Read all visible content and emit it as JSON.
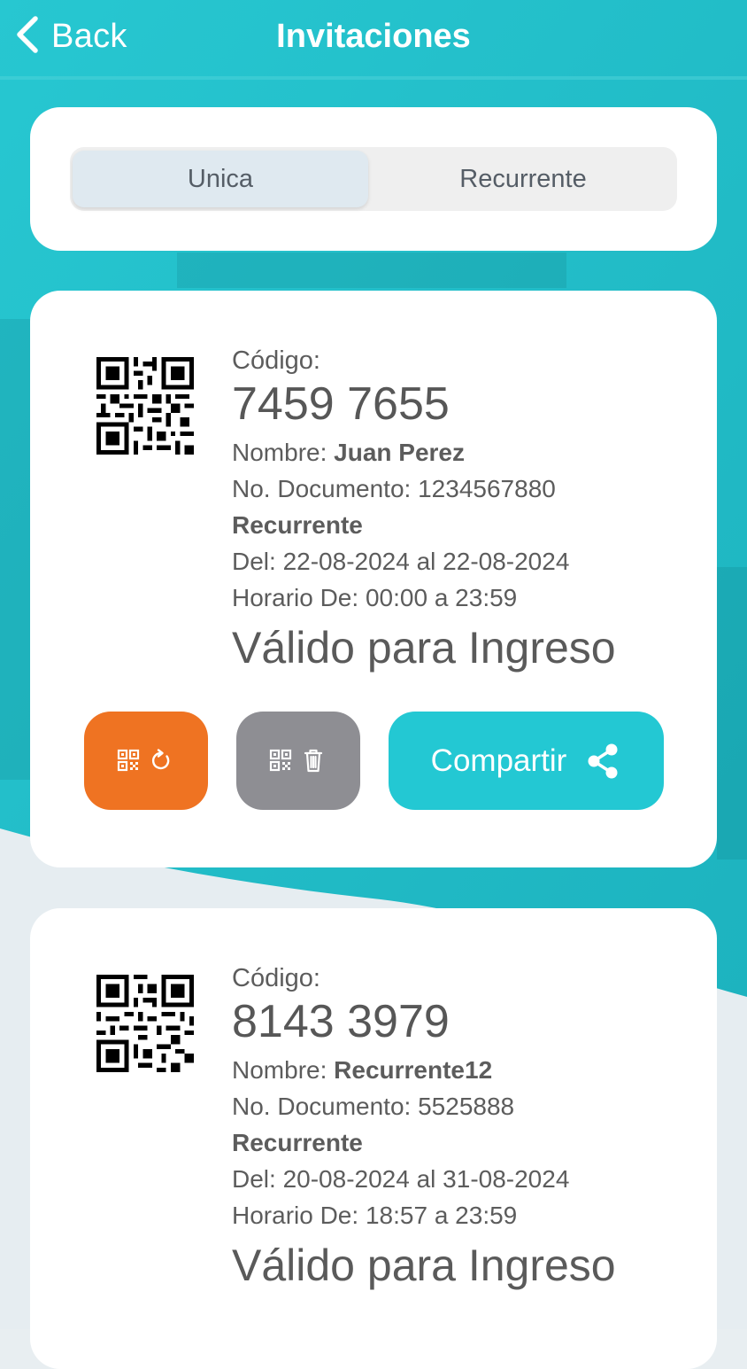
{
  "header": {
    "back_label": "Back",
    "title": "Invitaciones"
  },
  "segments": {
    "selected": "Unica",
    "options": [
      "Unica",
      "Recurrente"
    ]
  },
  "invitations": [
    {
      "code_label": "Código:",
      "code": "7459 7655",
      "name_label": "Nombre:",
      "name": "Juan Perez",
      "doc_label": "No. Documento:",
      "doc_number": "1234567880",
      "type": "Recurrente",
      "date_label": "Del:",
      "date_from": "22-08-2024",
      "date_sep": "al",
      "date_to": "22-08-2024",
      "time_label": "Horario De:",
      "time_from": "00:00",
      "time_sep": "a",
      "time_to": "23:59",
      "status": "Válido para Ingreso",
      "share_label": "Compartir"
    },
    {
      "code_label": "Código:",
      "code": "8143 3979",
      "name_label": "Nombre:",
      "name": "Recurrente12",
      "doc_label": "No. Documento:",
      "doc_number": "5525888",
      "type": "Recurrente",
      "date_label": "Del:",
      "date_from": "20-08-2024",
      "date_sep": "al",
      "date_to": "31-08-2024",
      "time_label": "Horario De:",
      "time_from": "18:57",
      "time_sep": "a",
      "time_to": "23:59",
      "status": "Válido para Ingreso"
    }
  ],
  "icons": {
    "back": "chevron-left-icon",
    "renew": "qr-refresh-icon",
    "delete": "qr-trash-icon",
    "share": "share-icon"
  },
  "colors": {
    "header_teal": "#26c5cf",
    "renew_orange": "#ef7322",
    "delete_gray": "#8e8e93",
    "share_teal": "#23c8d3",
    "text_gray": "#5c5c5c"
  }
}
